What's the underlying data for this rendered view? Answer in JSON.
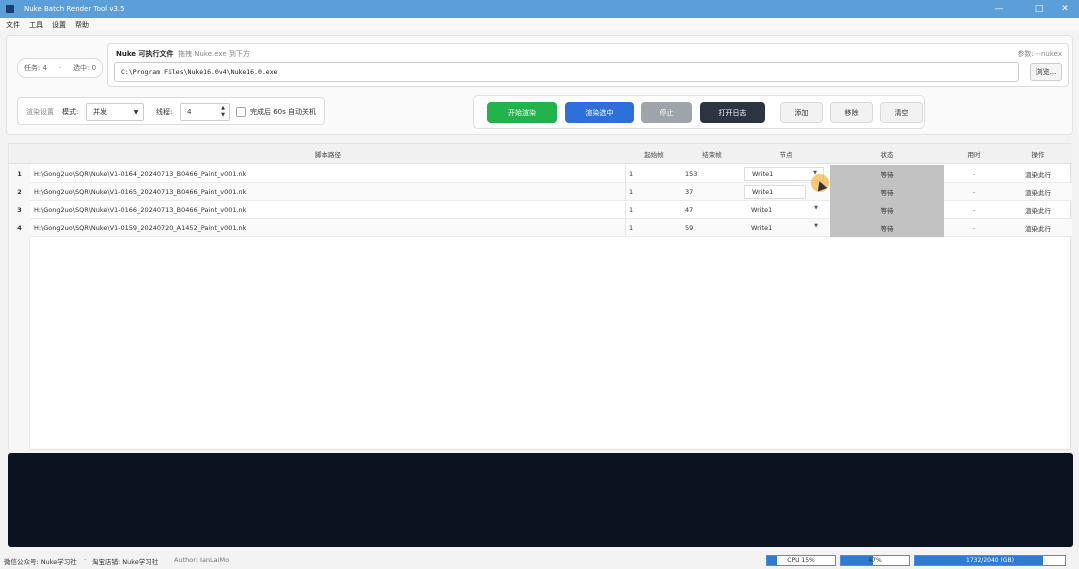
{
  "window": {
    "title": "Nuke Batch Render Tool v3.5"
  },
  "menu": [
    "文件",
    "工具",
    "设置",
    "帮助"
  ],
  "tasks": {
    "task_label": "任务: 4",
    "selected_label": "选中: 0"
  },
  "exe": {
    "title": "Nuke 可执行文件",
    "hint": "拖拽 Nuke.exe 到下方",
    "param": "参数: --nukex",
    "path": "C:\\Program Files\\Nuke16.0v4\\Nuke16.0.exe",
    "browse": "浏览..."
  },
  "render_settings": {
    "section": "渲染设置",
    "mode_label": "模式:",
    "mode_value": "并发",
    "threads_label": "线程:",
    "threads_value": "4",
    "shutdown_label": "完成后 60s 自动关机"
  },
  "actions": {
    "start": "开始渲染",
    "render_selected": "渲染选中",
    "stop": "停止",
    "open_log": "打开日志",
    "add": "添加",
    "remove": "移除",
    "clear": "清空"
  },
  "table": {
    "headers": [
      "脚本路径",
      "起始帧",
      "结束帧",
      "节点",
      "状态",
      "用时",
      "操作"
    ],
    "rows": [
      {
        "num": "1",
        "path": "H:\\Gong2uo\\SQR\\Nuke\\V1-0164_20240713_B0466_Paint_v001.nk",
        "start": "1",
        "end": "153",
        "node": "Write1",
        "status": "等待",
        "time": "-",
        "action": "渲染此行"
      },
      {
        "num": "2",
        "path": "H:\\Gong2uo\\SQR\\Nuke\\V1-0165_20240713_B0466_Paint_v001.nk",
        "start": "1",
        "end": "37",
        "node": "Write1",
        "status": "等待",
        "time": "-",
        "action": "渲染此行"
      },
      {
        "num": "3",
        "path": "H:\\Gong2uo\\SQR\\Nuke\\V1-0166_20240713_B0466_Paint_v001.nk",
        "start": "1",
        "end": "47",
        "node": "Write1",
        "status": "等待",
        "time": "-",
        "action": "渲染此行"
      },
      {
        "num": "4",
        "path": "H:\\Gong2uo\\SQR\\Nuke\\V1-0159_20240720_A1452_Paint_v001.nk",
        "start": "1",
        "end": "59",
        "node": "Write1",
        "status": "等待",
        "time": "-",
        "action": "渲染此行"
      }
    ]
  },
  "statusbar": {
    "wechat": "微信公众号: Nuke学习社",
    "sep": "·",
    "taobao": "淘宝店铺: Nuke学习社",
    "author": "Author: IanLaiMo",
    "cpu": {
      "label": "CPU 15%",
      "value": 15
    },
    "mem": {
      "label": "47%",
      "value": 47
    },
    "disk": {
      "label": "1732/2040 (GB)",
      "value": 85
    }
  },
  "colors": {
    "titlebar": "#5b9ed8",
    "start": "#22b24c",
    "render_selected": "#2f6fdc",
    "stop": "#9ea4aa",
    "open_log": "#2b3440",
    "log_bg": "#0b1320"
  }
}
